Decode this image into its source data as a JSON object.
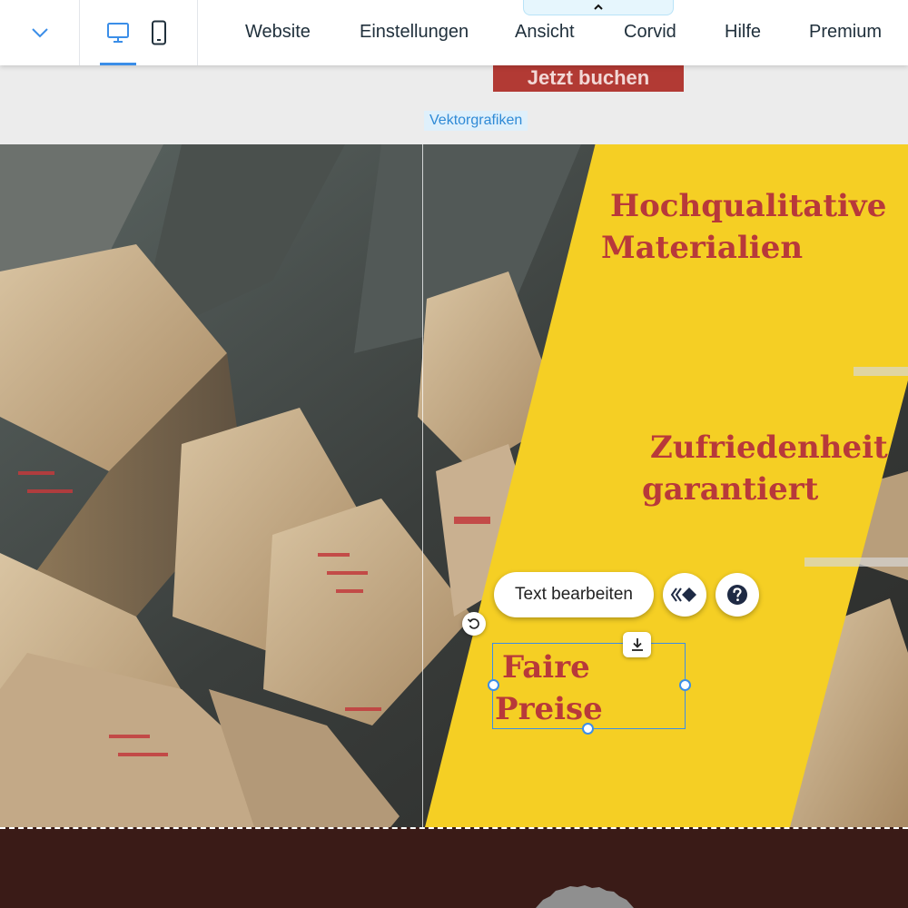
{
  "topbar": {
    "menu": [
      {
        "label": "Website"
      },
      {
        "label": "Einstellungen"
      },
      {
        "label": "Ansicht"
      },
      {
        "label": "Corvid"
      },
      {
        "label": "Hilfe"
      },
      {
        "label": "Premium"
      }
    ]
  },
  "canvas": {
    "book_button_label": "Jetzt buchen",
    "section_label": "Vektorgrafiken",
    "headline_1": [
      "Hochqualitative",
      "Materialien"
    ],
    "headline_2": [
      "Zufriedenheit",
      "garantiert"
    ],
    "headline_3": [
      "Faire",
      "Preise"
    ]
  },
  "floating_toolbar": {
    "edit_text_label": "Text bearbeiten",
    "animation_icon": "animation-icon",
    "help_icon": "help-icon"
  },
  "colors": {
    "accent": "#3b8ee8",
    "yellow_panel": "#f5cf24",
    "headline": "#b8393a",
    "button_red": "#b23a34",
    "footer": "#3a1b17"
  }
}
